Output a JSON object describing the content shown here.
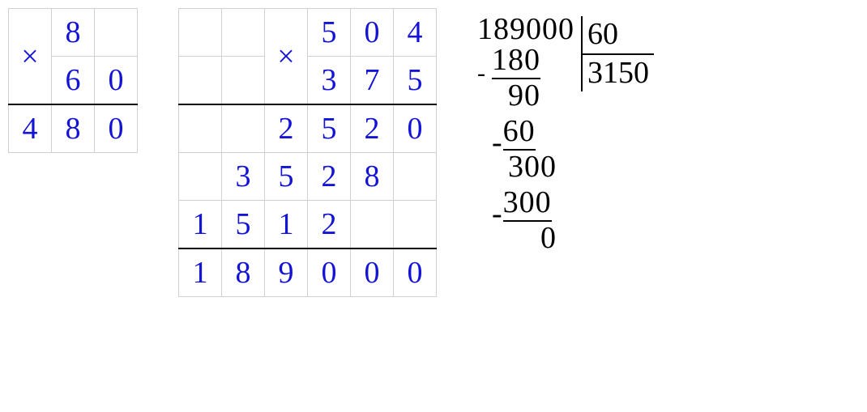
{
  "mult1": {
    "symbol": "×",
    "row1": [
      "",
      "8",
      ""
    ],
    "row2": [
      "",
      "6",
      "0"
    ],
    "result": [
      "4",
      "8",
      "0"
    ]
  },
  "mult2": {
    "symbol": "×",
    "row1": [
      "",
      "",
      "",
      "5",
      "0",
      "4"
    ],
    "row2": [
      "",
      "",
      "",
      "3",
      "7",
      "5"
    ],
    "p1": [
      "",
      "",
      "2",
      "5",
      "2",
      "0"
    ],
    "p2": [
      "",
      "3",
      "5",
      "2",
      "8",
      ""
    ],
    "p3": [
      "1",
      "5",
      "1",
      "2",
      "",
      ""
    ],
    "result": [
      "1",
      "8",
      "9",
      "0",
      "0",
      "0"
    ]
  },
  "division": {
    "dividend": "189000",
    "divisor": "60",
    "quotient": "3150",
    "minus": "-",
    "steps": {
      "s1": "180",
      "r1": "90",
      "s2": "60",
      "r2": "300",
      "s3": "300",
      "r3": "0"
    }
  },
  "chart_data": [
    {
      "type": "table",
      "title": "Multiplication 8 × 60",
      "operand1": 8,
      "operand2": 60,
      "result": 480
    },
    {
      "type": "table",
      "title": "Multiplication 504 × 375",
      "operand1": 504,
      "operand2": 375,
      "partial_products": [
        2520,
        35280,
        151200
      ],
      "partial_rows_as_written": [
        2520,
        3528,
        1512
      ],
      "result": 189000
    },
    {
      "type": "table",
      "title": "Long division 189000 ÷ 60",
      "dividend": 189000,
      "divisor": 60,
      "quotient": 3150,
      "remainder": 0,
      "work": [
        {
          "bring": 189,
          "sub": 180,
          "rem": 9
        },
        {
          "bring": 90,
          "sub": 60,
          "rem": 30
        },
        {
          "bring": 300,
          "sub": 300,
          "rem": 0
        },
        {
          "bring": 0,
          "sub": 0,
          "rem": 0
        }
      ]
    }
  ]
}
